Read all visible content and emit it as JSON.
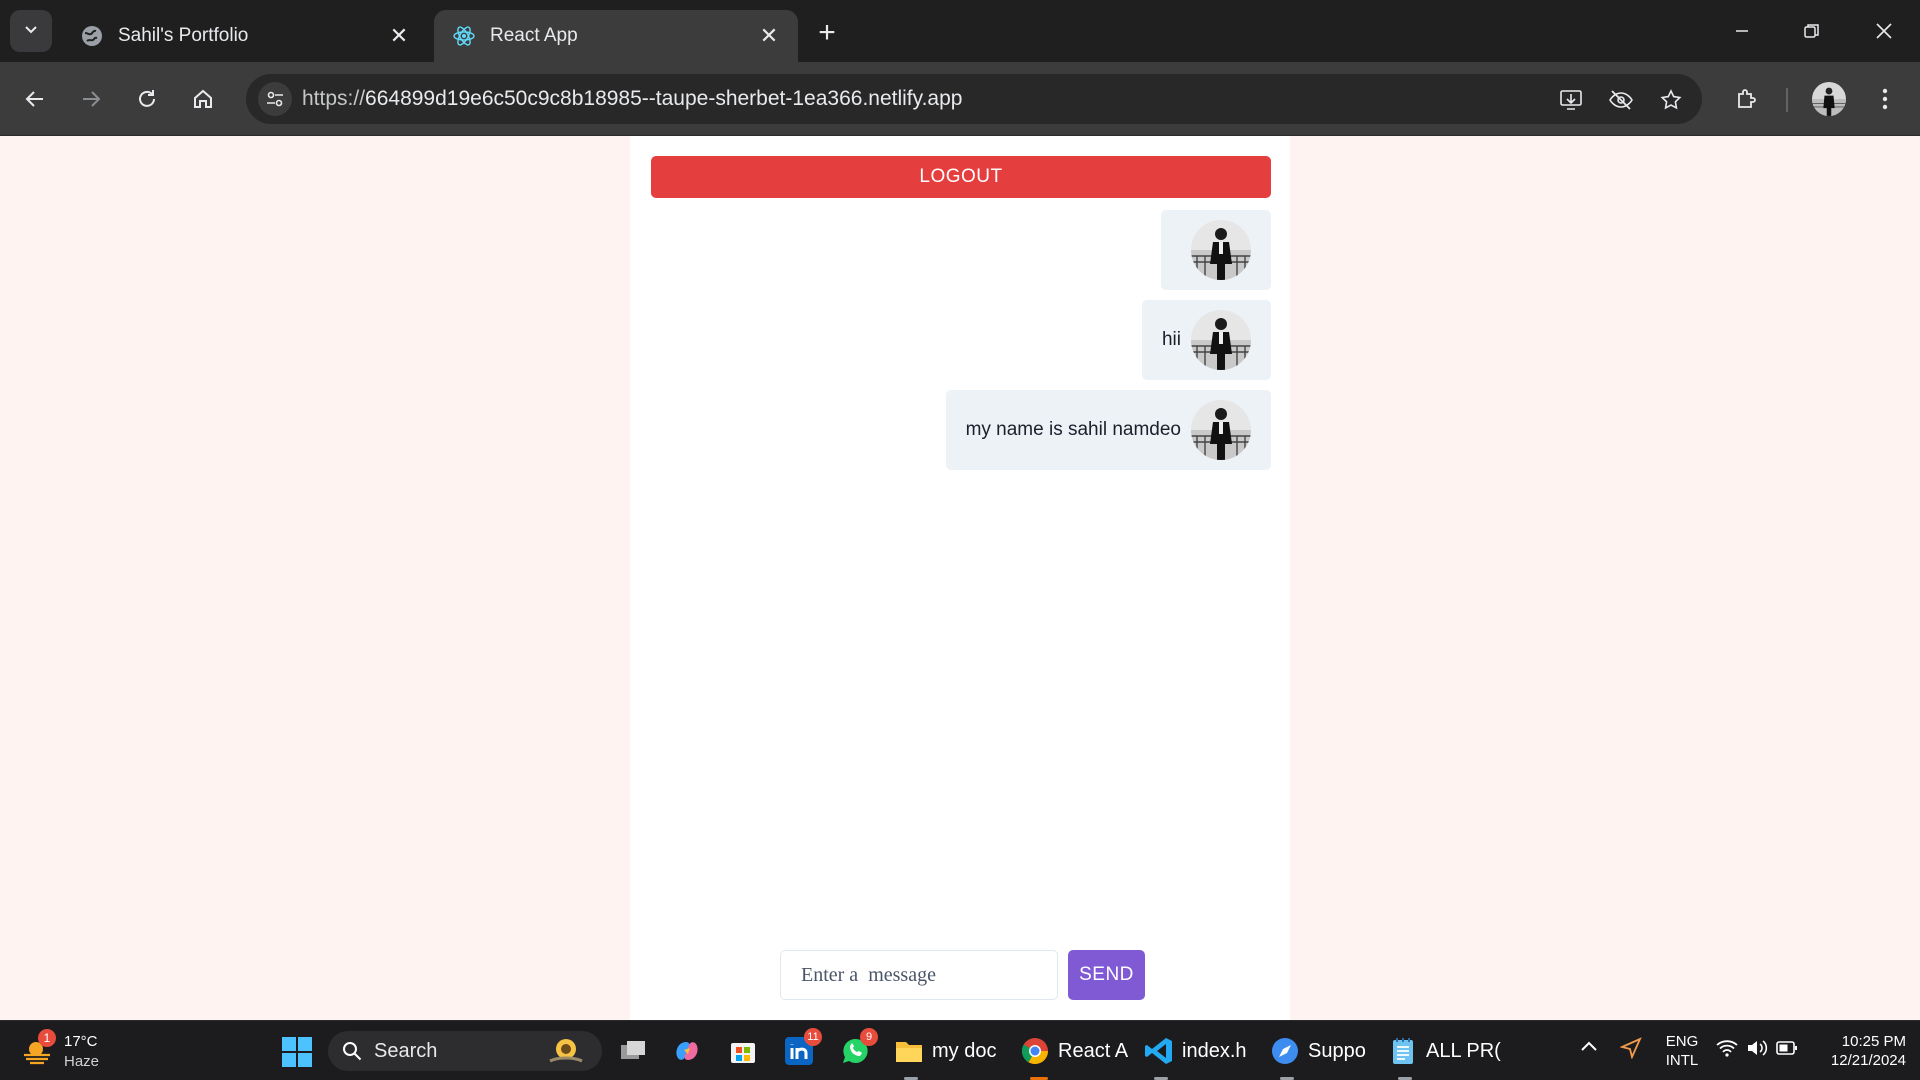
{
  "browser": {
    "tabs": [
      {
        "title": "Sahil's Portfolio",
        "active": false,
        "icon": "globe-icon"
      },
      {
        "title": "React App",
        "active": true,
        "icon": "react-icon"
      }
    ],
    "url_scheme": "https://",
    "url_host": "664899d19e6c50c9c8b18985--taupe-sherbet-1ea366.netlify.app"
  },
  "app": {
    "logout_label": "LOGOUT",
    "messages": [
      {
        "text": ""
      },
      {
        "text": "hii"
      },
      {
        "text": "my name is sahil namdeo"
      }
    ],
    "input_value": "",
    "input_placeholder": "Enter a  message",
    "send_label": "SEND",
    "colors": {
      "logout": "#e53e3e",
      "send": "#805ad5",
      "bubble": "#edf2f7",
      "page_bg": "#fff3f1"
    }
  },
  "taskbar": {
    "weather_badge": "1",
    "weather_temp": "17°C",
    "weather_cond": "Haze",
    "search_label": "Search",
    "apps": [
      {
        "name": "task-view",
        "label": ""
      },
      {
        "name": "copilot",
        "label": ""
      },
      {
        "name": "store",
        "label": ""
      },
      {
        "name": "linkedin",
        "label": "",
        "badge": "11"
      },
      {
        "name": "whatsapp",
        "label": "",
        "badge": "9"
      },
      {
        "name": "file-explorer",
        "label": "my doc"
      },
      {
        "name": "chrome",
        "label": "React A"
      },
      {
        "name": "vscode",
        "label": "index.h"
      },
      {
        "name": "support",
        "label": "Suppo"
      },
      {
        "name": "notepad",
        "label": "ALL PR("
      }
    ],
    "lang_top": "ENG",
    "lang_bottom": "INTL",
    "time": "10:25 PM",
    "date": "12/21/2024"
  }
}
